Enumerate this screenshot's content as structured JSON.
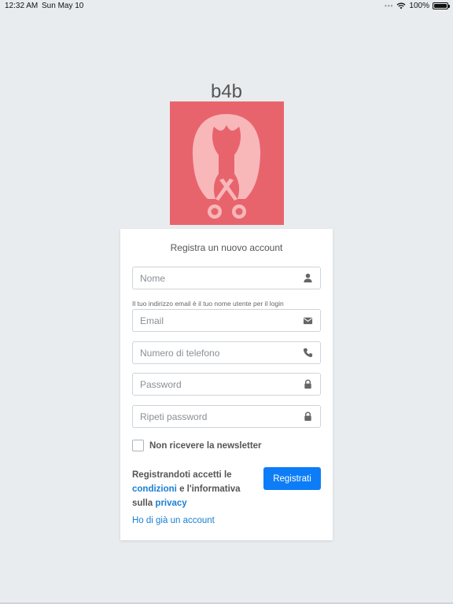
{
  "status_bar": {
    "time": "12:32 AM",
    "date": "Sun May 10",
    "battery": "100%",
    "battery_level": 1.0
  },
  "app": {
    "brand": "b4b",
    "logo_color": "#e8646d",
    "logo_figure_color": "#f8b7b9"
  },
  "form": {
    "title": "Registra un nuovo account",
    "name": {
      "placeholder": "Nome",
      "icon": "user-icon"
    },
    "email_hint": "Il tuo indirizzo email è il tuo nome utente per il login",
    "email": {
      "placeholder": "Email",
      "icon": "envelope-icon"
    },
    "phone": {
      "placeholder": "Numero di telefono",
      "icon": "phone-icon"
    },
    "password": {
      "placeholder": "Password",
      "icon": "lock-icon"
    },
    "password_repeat": {
      "placeholder": "Ripeti password",
      "icon": "lock-icon"
    },
    "newsletter_label": "Non ricevere la newsletter",
    "newsletter_checked": false,
    "terms": {
      "text_1": "Registrandoti accetti le",
      "conditions_link": "condizioni",
      "text_2": "e l'informativa sulla",
      "privacy_link": "privacy"
    },
    "submit_label": "Registrati",
    "login_link": "Ho di già un account"
  },
  "colors": {
    "accent": "#0d7df7",
    "link": "#1a7fd4",
    "background": "#e9ecef"
  }
}
